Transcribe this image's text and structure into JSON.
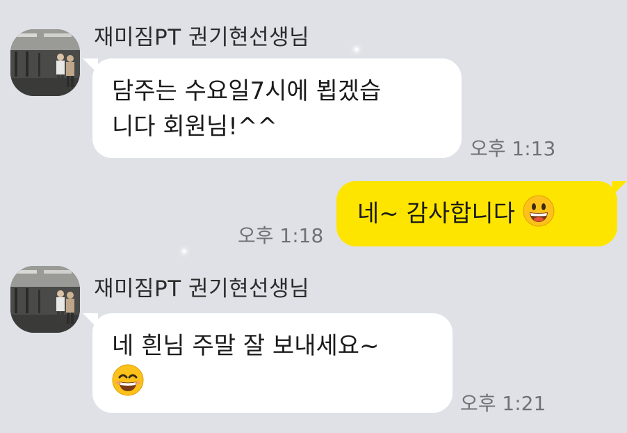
{
  "chat": {
    "background_color": "#dfe1e7",
    "incoming_bubble_color": "#ffffff",
    "outgoing_bubble_color": "#fee500",
    "messages": [
      {
        "direction": "incoming",
        "sender": "재미짐PT 권기현선생님",
        "avatar_icon": "gym-photo-avatar",
        "lines": [
          "담주는 수요일7시에 뵙겠습",
          "니다 회원님!^^"
        ],
        "time": "오후 1:13"
      },
      {
        "direction": "outgoing",
        "text": "네~ 감사합니다",
        "emoji": "grinning-face",
        "time": "오후 1:18"
      },
      {
        "direction": "incoming",
        "sender": "재미짐PT 권기현선생님",
        "avatar_icon": "gym-photo-avatar",
        "lines": [
          "네 흰님 주말 잘 보내세요~"
        ],
        "emoji": "smiling-face-with-smiling-eyes",
        "time": "오후 1:21"
      }
    ]
  }
}
